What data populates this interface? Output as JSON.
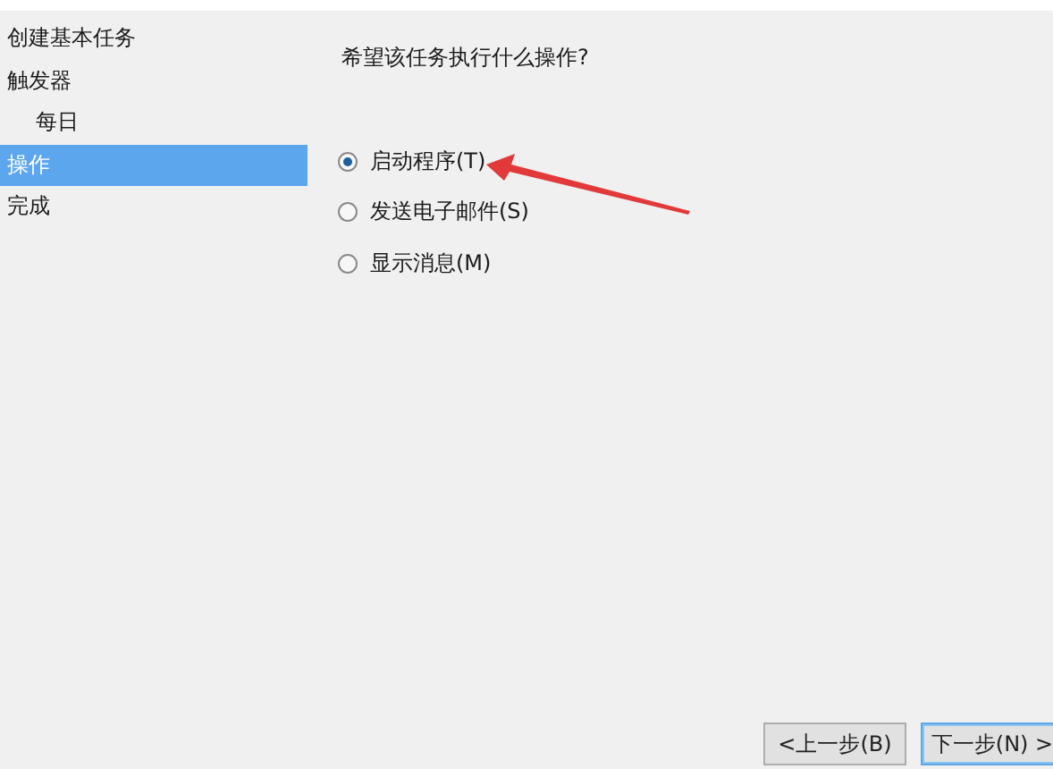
{
  "steps": [
    {
      "label": "创建基本任务",
      "selected": false
    },
    {
      "label": "触发器",
      "selected": false,
      "children": [
        {
          "label": "每日",
          "selected": false
        }
      ]
    },
    {
      "label": "操作",
      "selected": true
    },
    {
      "label": "完成",
      "selected": false
    }
  ],
  "question": "希望该任务执行什么操作?",
  "options": [
    {
      "label": "启动程序(T)",
      "selected": true
    },
    {
      "label": "发送电子邮件(S)",
      "selected": false
    },
    {
      "label": "显示消息(M)",
      "selected": false
    }
  ],
  "buttons": [
    {
      "label": "<上一步(B)",
      "kind": "normal"
    },
    {
      "label": "下一步(N) >",
      "kind": "default"
    }
  ]
}
